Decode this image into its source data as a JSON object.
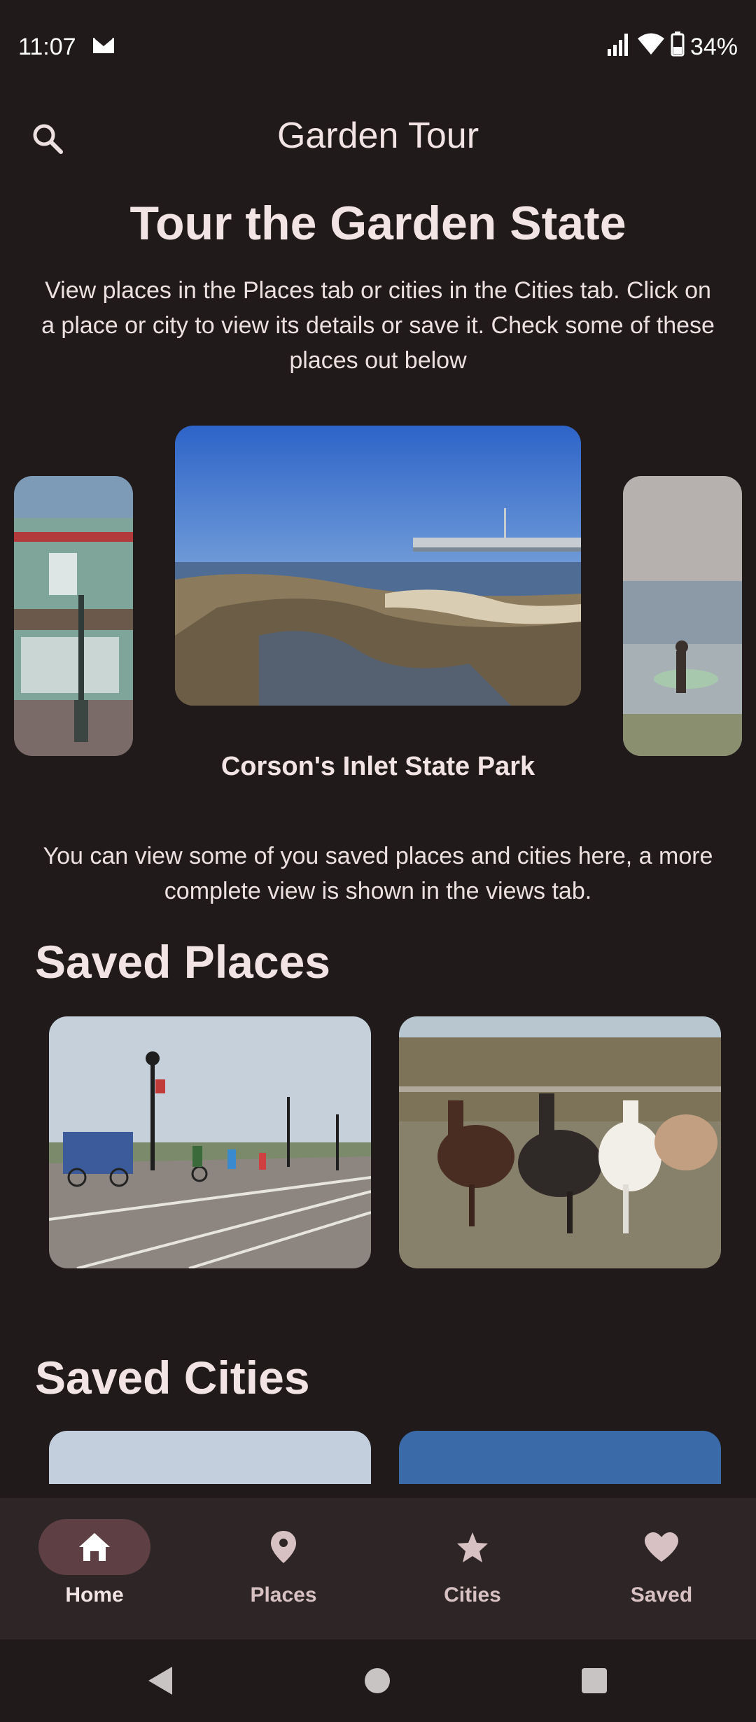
{
  "status_bar": {
    "time": "11:07",
    "battery": "34%",
    "icons": [
      "gmail-icon",
      "signal-icon",
      "wifi-icon",
      "battery-icon"
    ]
  },
  "app_bar": {
    "title": "Garden Tour",
    "search_icon": "search-icon"
  },
  "hero": {
    "title": "Tour the Garden State",
    "intro": "View places in the Places tab or cities in the Cities tab. Click on a place or city to view its details or save it. Check some of these places out below"
  },
  "carousel": {
    "caption": "Corson's Inlet State Park"
  },
  "saved_note": "You can view some of you saved places and cities here, a more complete view is shown in the views tab.",
  "saved_places": {
    "title": "Saved Places"
  },
  "saved_cities": {
    "title": "Saved Cities"
  },
  "bottom_nav": {
    "items": [
      {
        "label": "Home",
        "icon": "home-icon",
        "active": true
      },
      {
        "label": "Places",
        "icon": "location-pin-icon",
        "active": false
      },
      {
        "label": "Cities",
        "icon": "star-icon",
        "active": false
      },
      {
        "label": "Saved",
        "icon": "heart-icon",
        "active": false
      }
    ]
  },
  "colors": {
    "background": "#201a1b",
    "nav_background": "#2e2526",
    "active_indicator": "#5e3f43",
    "text": "#ede0e0"
  }
}
